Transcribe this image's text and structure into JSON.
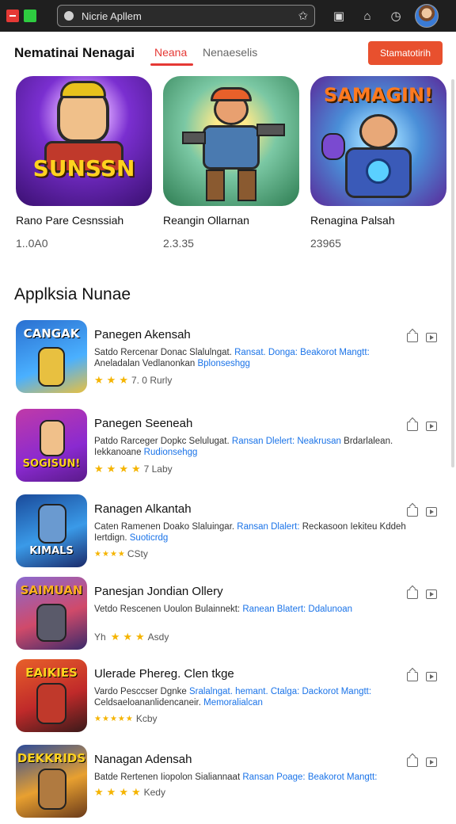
{
  "browser": {
    "url": "Nicrie Apllem"
  },
  "header": {
    "title": "Nematinai Nenagai",
    "tabs": [
      {
        "label": "Neana",
        "active": true
      },
      {
        "label": "Nenaeselis",
        "active": false
      }
    ],
    "cta_label": "Stamatotirih"
  },
  "featured": [
    {
      "name": "Rano Pare Cesnssiah",
      "count": "1..0A0",
      "logo": "SUNSSN"
    },
    {
      "name": "Reangin Ollarnan",
      "count": "2.3.35",
      "logo": ""
    },
    {
      "name": "Renagina Palsah",
      "count": "23965",
      "logo": "SAMAGIN!"
    }
  ],
  "section": {
    "title": "Applksia Nunae"
  },
  "items": [
    {
      "title": "Panegen Akensah",
      "desc_plain": "Satdo Rercenar Donac Slalulngat. ",
      "desc_highlight": "Ransat. Donga: Beakorot Mangtt: ",
      "desc_plain2": "Aneladalan Vedlanonkan ",
      "desc_highlight2": "Bplonseshgg",
      "stars": 3,
      "rating_text": "7. 0 Rurly",
      "thumb_text": "CANGAK"
    },
    {
      "title": "Panegen Seeneah",
      "desc_plain": "Patdo Rarceger Dopkc Selulugat. ",
      "desc_highlight": "Ransan Dlelert: Neakrusan ",
      "desc_plain2": "Brdarlalean. Iekkanoane ",
      "desc_highlight2": "Rudionsehgg",
      "stars": 4,
      "rating_text": "7 Laby",
      "thumb_text": "SOGISUN!"
    },
    {
      "title": "Ranagen Alkantah",
      "desc_plain": "Caten Ramenen Doako Slaluingar. ",
      "desc_highlight": "Ransan Dlalert: ",
      "desc_plain2": "Reckasoon Iekiteu Kddeh Iertdign. ",
      "desc_highlight2": "Suoticrdg",
      "stars": 4,
      "rating_text": "CSty",
      "thumb_text": "KIMALS"
    },
    {
      "title": "Panesjan Jondian Ollery",
      "desc_plain": "Vetdo Rescenen Uoulon Bulainnekt: ",
      "desc_highlight": "Ranean Blatert: Ddalunoan",
      "desc_plain2": "",
      "desc_highlight2": "",
      "stars": 3,
      "rating_text": "Asdy",
      "prefix": "Yh",
      "thumb_text": "SAIMUAN"
    },
    {
      "title": "Ulerade Phereg. Clen tkge",
      "desc_plain": "Vardo Pesccser Dgnke ",
      "desc_highlight": "Sralalngat. hemant. Ctalga: Dackorot Mangtt: ",
      "desc_plain2": "Celdsaeloananlidencaneir. ",
      "desc_highlight2": "Memoralialcan",
      "stars": 5,
      "rating_text": "Kcby",
      "thumb_text": "EAIKIES"
    },
    {
      "title": "Nanagan Adensah",
      "desc_plain": "Batde Rertenen Iiopolon Sialiannaat ",
      "desc_highlight": "Ransan Poage: Beakorot Mangtt:",
      "desc_plain2": "",
      "desc_highlight2": "",
      "stars": 4,
      "rating_text": "Kedy",
      "thumb_text": "DEKKRIDS"
    }
  ],
  "colors": {
    "accent": "#e53935",
    "cta": "#e8502e",
    "link": "#1a73e8",
    "star": "#f5b400"
  }
}
